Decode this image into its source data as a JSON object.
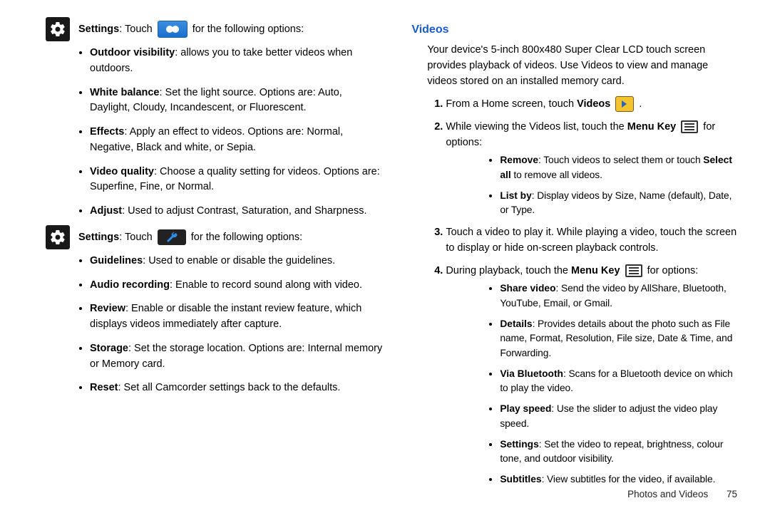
{
  "left": {
    "settings1_label": "Settings",
    "settings1_pre": ": Touch",
    "settings1_post": "for the following options:",
    "group1": [
      {
        "b": "Outdoor visibility",
        "t": ": allows you to take better videos when outdoors."
      },
      {
        "b": "White balance",
        "t": ": Set the light source. Options are: Auto, Daylight, Cloudy, Incandescent, or Fluorescent."
      },
      {
        "b": "Effects",
        "t": ": Apply an effect to videos. Options are: Normal, Negative, Black and white, or Sepia."
      },
      {
        "b": "Video quality",
        "t": ": Choose a quality setting for videos. Options are: Superfine, Fine, or Normal."
      },
      {
        "b": "Adjust",
        "t": ": Used to adjust Contrast, Saturation, and Sharpness."
      }
    ],
    "settings2_label": "Settings",
    "settings2_pre": ": Touch",
    "settings2_post": "for the following options:",
    "group2": [
      {
        "b": "Guidelines",
        "t": ": Used to enable or disable the guidelines."
      },
      {
        "b": "Audio recording",
        "t": ": Enable to record sound along with video."
      },
      {
        "b": "Review",
        "t": ": Enable or disable the instant review feature, which displays videos immediately after capture."
      },
      {
        "b": "Storage",
        "t": ": Set the storage location. Options are: Internal memory or Memory card."
      },
      {
        "b": "Reset",
        "t": ": Set all Camcorder settings back to the defaults."
      }
    ]
  },
  "right": {
    "heading": "Videos",
    "intro": "Your device's 5-inch 800x480 Super Clear LCD touch screen provides playback of videos. Use Videos to view and manage videos stored on an installed memory card.",
    "step1_pre": "From a Home screen, touch ",
    "step1_bold": "Videos",
    "step2_pre": "While viewing the Videos list, touch the ",
    "step2_bold": "Menu Key",
    "step2_post": " for options:",
    "step2_items": [
      {
        "b": "Remove",
        "t": ": Touch videos to select them or touch ",
        "b2": "Select all",
        "t2": " to remove all videos."
      },
      {
        "b": "List by",
        "t": ": Display videos by Size, Name (default), Date, or Type."
      }
    ],
    "step3": "Touch a video to play it. While playing a video, touch the screen to display or hide on-screen playback controls.",
    "step4_pre": "During playback, touch the ",
    "step4_bold": "Menu Key",
    "step4_post": " for options:",
    "step4_items": [
      {
        "b": "Share video",
        "t": ": Send the video by AllShare, Bluetooth, YouTube, Email, or Gmail."
      },
      {
        "b": "Details",
        "t": ": Provides details about the photo such as File name, Format, Resolution, File size, Date & Time, and Forwarding."
      },
      {
        "b": "Via Bluetooth",
        "t": ": Scans for a Bluetooth device on which to play the video."
      },
      {
        "b": "Play speed",
        "t": ": Use the slider to adjust the video play speed."
      },
      {
        "b": "Settings",
        "t": ": Set the video to repeat, brightness, colour tone, and outdoor visibility."
      },
      {
        "b": "Subtitles",
        "t": ": View subtitles for the video, if available."
      }
    ]
  },
  "footer": {
    "section": "Photos and Videos",
    "page": "75"
  }
}
